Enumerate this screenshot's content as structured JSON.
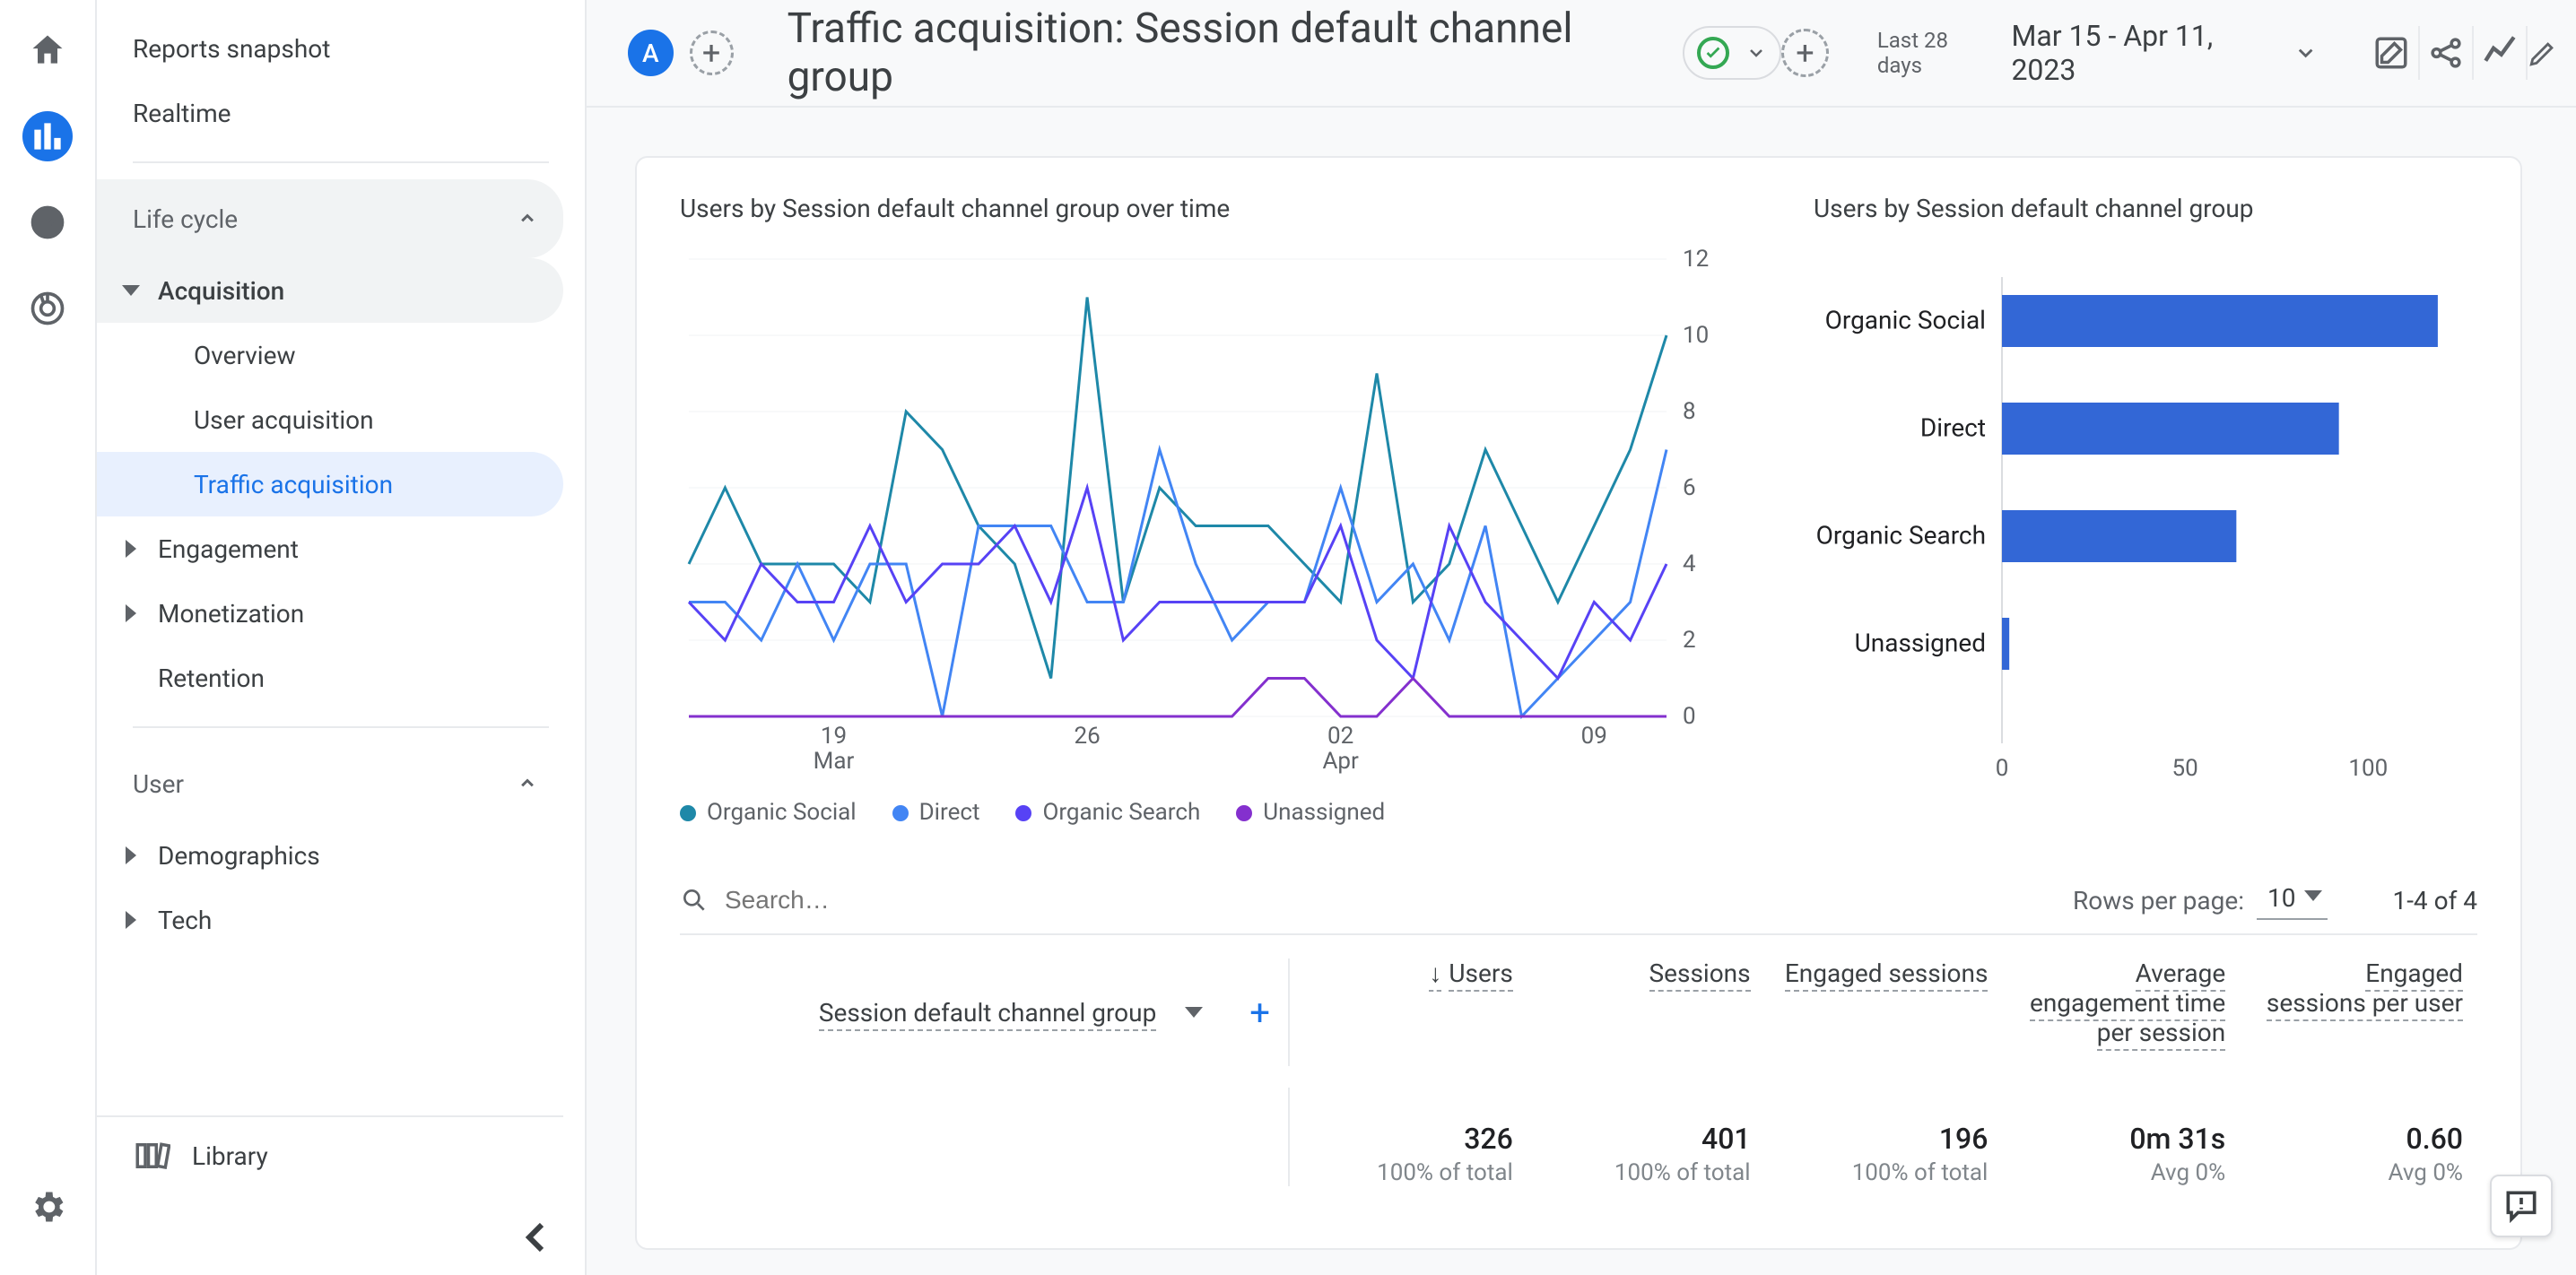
{
  "rail": {
    "home": "home-icon",
    "reports": "bar-chart-icon",
    "explore": "explore-icon",
    "ads": "target-icon",
    "settings": "gear-icon"
  },
  "sidebar": {
    "snapshot": "Reports snapshot",
    "realtime": "Realtime",
    "life_cycle": "Life cycle",
    "acquisition": "Acquisition",
    "acq_children": {
      "overview": "Overview",
      "user_acq": "User acquisition",
      "traffic_acq": "Traffic acquisition"
    },
    "engagement": "Engagement",
    "monetization": "Monetization",
    "retention": "Retention",
    "user": "User",
    "demographics": "Demographics",
    "tech": "Tech",
    "library": "Library"
  },
  "header": {
    "avatar": "A",
    "title": "Traffic acquisition: Session default channel group",
    "date_sub": "Last 28 days",
    "date_range": "Mar 15 - Apr 11, 2023"
  },
  "chart1_title": "Users by Session default channel group over time",
  "chart2_title": "Users by Session default channel group",
  "legend": {
    "a": "Organic Social",
    "b": "Direct",
    "c": "Organic Search",
    "d": "Unassigned"
  },
  "chart_colors": {
    "a": "#1e88a8",
    "b": "#4285f4",
    "c": "#5742f5",
    "d": "#8430ce"
  },
  "toolbar": {
    "search_ph": "Search…",
    "rpp_label": "Rows per page:",
    "rpp_value": "10",
    "range": "1-4 of 4"
  },
  "table": {
    "dimension": "Session default channel group",
    "cols": [
      "Users",
      "Sessions",
      "Engaged sessions",
      "Average engagement time per session",
      "Engaged sessions per user"
    ],
    "totals": {
      "users": {
        "v": "326",
        "s": "100% of total"
      },
      "sessions": {
        "v": "401",
        "s": "100% of total"
      },
      "engaged": {
        "v": "196",
        "s": "100% of total"
      },
      "avgeng": {
        "v": "0m 31s",
        "s": "Avg 0%"
      },
      "espu": {
        "v": "0.60",
        "s": "Avg 0%"
      }
    }
  },
  "chart_data": [
    {
      "type": "line",
      "title": "Users by Session default channel group over time",
      "ylabel": "",
      "xlabel": "",
      "ylim": [
        0,
        12
      ],
      "yticks": [
        0,
        2,
        4,
        6,
        8,
        10,
        12
      ],
      "xticks": [
        "19 Mar",
        "26",
        "02 Apr",
        "09"
      ],
      "x": [
        "Mar 15",
        "Mar 16",
        "Mar 17",
        "Mar 18",
        "Mar 19",
        "Mar 20",
        "Mar 21",
        "Mar 22",
        "Mar 23",
        "Mar 24",
        "Mar 25",
        "Mar 26",
        "Mar 27",
        "Mar 28",
        "Mar 29",
        "Mar 30",
        "Mar 31",
        "Apr 01",
        "Apr 02",
        "Apr 03",
        "Apr 04",
        "Apr 05",
        "Apr 06",
        "Apr 07",
        "Apr 08",
        "Apr 09",
        "Apr 10",
        "Apr 11"
      ],
      "series": [
        {
          "name": "Organic Social",
          "color": "#1e88a8",
          "values": [
            4,
            6,
            4,
            4,
            4,
            3,
            8,
            7,
            5,
            4,
            1,
            11,
            3,
            6,
            5,
            5,
            5,
            4,
            3,
            9,
            3,
            4,
            7,
            5,
            3,
            5,
            7,
            10
          ]
        },
        {
          "name": "Direct",
          "color": "#4285f4",
          "values": [
            3,
            3,
            2,
            4,
            2,
            4,
            4,
            0,
            5,
            5,
            5,
            3,
            3,
            7,
            4,
            2,
            3,
            3,
            6,
            3,
            4,
            2,
            5,
            0,
            1,
            2,
            3,
            7
          ]
        },
        {
          "name": "Organic Search",
          "color": "#5742f5",
          "values": [
            3,
            2,
            4,
            3,
            3,
            5,
            3,
            4,
            4,
            5,
            3,
            6,
            2,
            3,
            3,
            3,
            3,
            3,
            5,
            2,
            1,
            5,
            3,
            2,
            1,
            3,
            2,
            4
          ]
        },
        {
          "name": "Unassigned",
          "color": "#8430ce",
          "values": [
            0,
            0,
            0,
            0,
            0,
            0,
            0,
            0,
            0,
            0,
            0,
            0,
            0,
            0,
            0,
            0,
            1,
            1,
            0,
            0,
            1,
            0,
            0,
            0,
            0,
            0,
            0,
            0
          ]
        }
      ]
    },
    {
      "type": "bar",
      "orientation": "horizontal",
      "title": "Users by Session default channel group",
      "xlim": [
        0,
        120
      ],
      "xticks": [
        0,
        50,
        100
      ],
      "categories": [
        "Organic Social",
        "Direct",
        "Organic Search",
        "Unassigned"
      ],
      "values": [
        119,
        92,
        64,
        2
      ],
      "color": "#3367d6"
    }
  ]
}
